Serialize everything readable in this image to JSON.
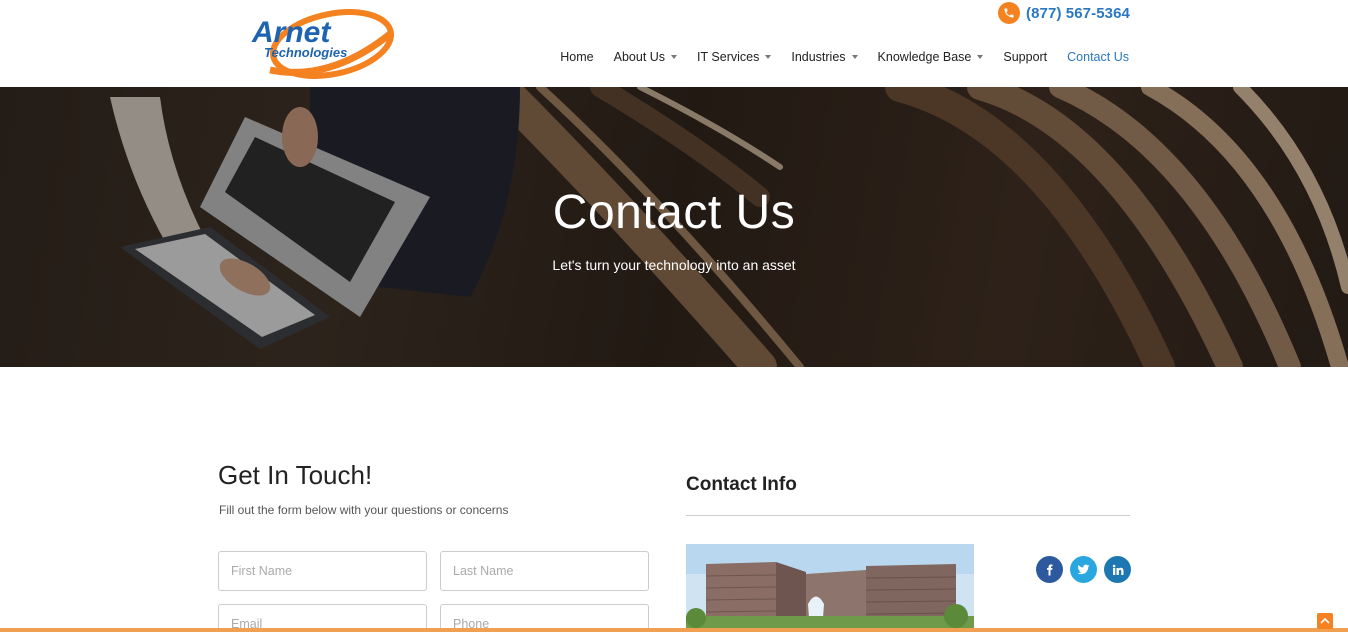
{
  "brand": {
    "logo_word1": "Arnet",
    "logo_word2": "Technologies",
    "primary_color": "#2a78c2",
    "accent_color": "#f58220"
  },
  "header": {
    "phone_icon": "phone-icon",
    "phone": "(877) 567-5364"
  },
  "nav": {
    "items": [
      {
        "label": "Home",
        "dropdown": false
      },
      {
        "label": "About Us",
        "dropdown": true
      },
      {
        "label": "IT Services",
        "dropdown": true
      },
      {
        "label": "Industries",
        "dropdown": true
      },
      {
        "label": "Knowledge Base",
        "dropdown": true
      },
      {
        "label": "Support",
        "dropdown": false
      },
      {
        "label": "Contact Us",
        "dropdown": false,
        "active": true
      }
    ]
  },
  "hero": {
    "title": "Contact Us",
    "subtitle": "Let's turn your technology into an asset"
  },
  "form": {
    "title": "Get In Touch!",
    "subtitle": "Fill out the form below with your questions or concerns",
    "first_name_placeholder": "First Name",
    "last_name_placeholder": "Last Name",
    "email_placeholder": "Email",
    "phone_placeholder": "Phone"
  },
  "contact_info": {
    "title": "Contact Info",
    "socials": [
      "facebook-icon",
      "twitter-icon",
      "linkedin-icon"
    ]
  }
}
